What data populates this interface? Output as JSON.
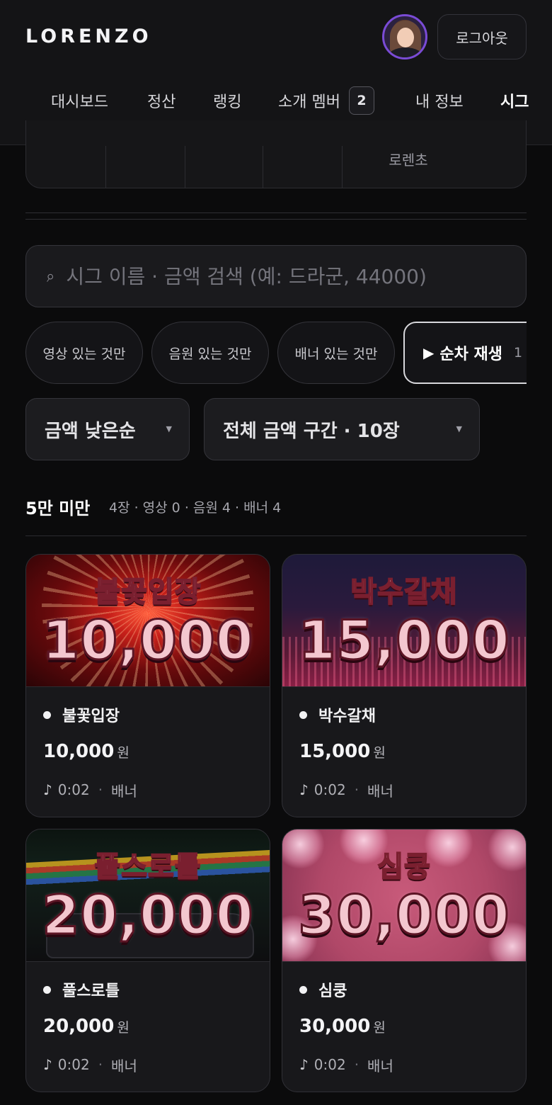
{
  "app": {
    "brand": "LORENZO",
    "logout_label": "로그아웃"
  },
  "nav": {
    "items": [
      {
        "label": "대시보드"
      },
      {
        "label": "정산"
      },
      {
        "label": "랭킹"
      },
      {
        "label": "소개 멤버",
        "badge": "2"
      },
      {
        "label": "내 정보"
      },
      {
        "label": "시그",
        "active": true
      }
    ]
  },
  "stats_card": {
    "visible_label": "로렌초"
  },
  "search": {
    "placeholder": "시그 이름 · 금액 검색 (예: 드라군, 44000)",
    "value": ""
  },
  "filters": {
    "chips": [
      "영상 있는 것만",
      "음원 있는 것만",
      "배너 있는 것만"
    ],
    "play_button": {
      "label": "순차 재생",
      "count": "1"
    }
  },
  "selects": {
    "sort": "금액 낮은순",
    "range": "전체 금액 구간 · 10장"
  },
  "section": {
    "title": "5만 미만",
    "meta": "4장 · 영상 0 · 음원 4 · 배너 4"
  },
  "cards": [
    {
      "banner_title": "불꽃입장",
      "banner_amount": "10,000",
      "name": "불꽃입장",
      "price": "10,000",
      "currency": "원",
      "duration": "0:02",
      "type": "배너",
      "theme": "fireworks"
    },
    {
      "banner_title": "박수갈채",
      "banner_amount": "15,000",
      "name": "박수갈채",
      "price": "15,000",
      "currency": "원",
      "duration": "0:02",
      "type": "배너",
      "theme": "crowd"
    },
    {
      "banner_title": "풀스로틀",
      "banner_amount": "20,000",
      "name": "풀스로틀",
      "price": "20,000",
      "currency": "원",
      "duration": "0:02",
      "type": "배너",
      "theme": "race"
    },
    {
      "banner_title": "심쿵",
      "banner_amount": "30,000",
      "name": "심쿵",
      "price": "30,000",
      "currency": "원",
      "duration": "0:02",
      "type": "배너",
      "theme": "heart"
    }
  ],
  "icons": {
    "search": "search-icon",
    "note": "music-note-icon",
    "play": "play-icon",
    "caret": "chevron-down-icon"
  },
  "colors": {
    "accent_underline": "#e07a8a",
    "background": "#0b0b0c",
    "card": "#18181b"
  }
}
